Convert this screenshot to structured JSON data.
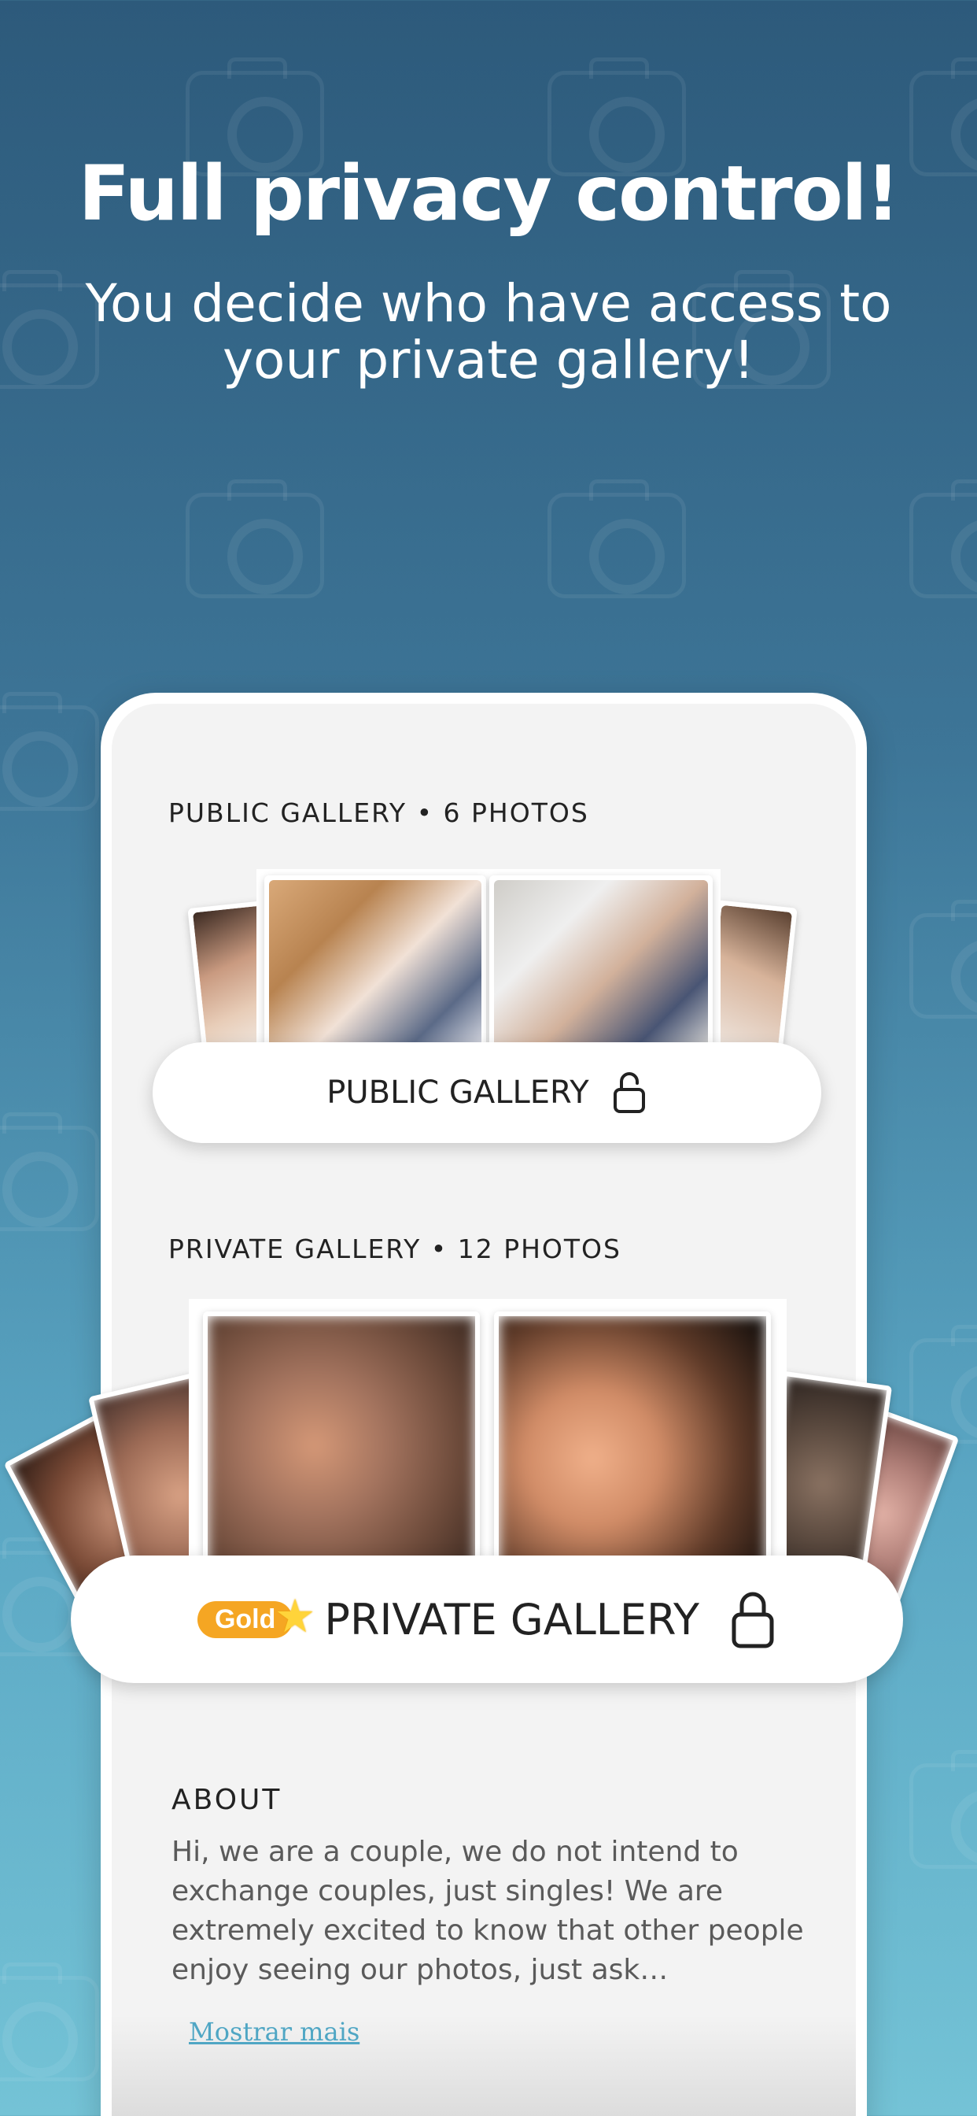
{
  "hero": {
    "title": "Full privacy control!",
    "subtitle": "You decide who have access to your private gallery!"
  },
  "public_gallery": {
    "label": "PUBLIC GALLERY • 6 PHOTOS",
    "button_label": "PUBLIC GALLERY",
    "lock_state": "unlocked"
  },
  "private_gallery": {
    "label": "PRIVATE GALLERY • 12 PHOTOS",
    "badge": "Gold",
    "button_label": "PRIVATE GALLERY",
    "lock_state": "locked"
  },
  "about": {
    "title": "ABOUT",
    "text": "Hi, we are a couple, we do not intend to exchange couples, just singles! We are extremely excited to know that other people enjoy seeing our photos, just ask…",
    "more_link": "Mostrar mais"
  },
  "colors": {
    "accent_link": "#4fa6c4",
    "gold": "#f5a623"
  }
}
